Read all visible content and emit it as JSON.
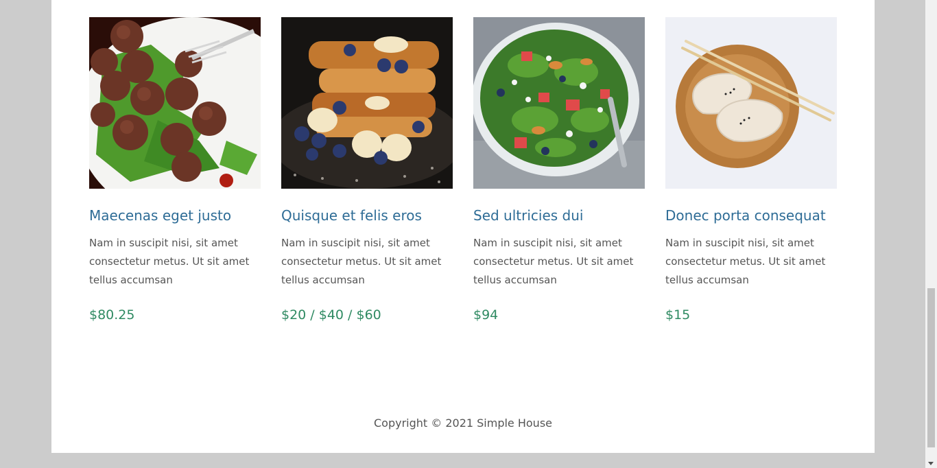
{
  "products": [
    {
      "title": "Maecenas eget justo",
      "description": "Nam in suscipit nisi, sit amet consectetur metus. Ut sit amet tellus accumsan",
      "price": "$80.25",
      "image": "meatballs-on-greens"
    },
    {
      "title": "Quisque et felis eros",
      "description": "Nam in suscipit nisi, sit amet consectetur metus. Ut sit amet tellus accumsan",
      "price": "$20 / $40 / $60",
      "image": "french-toast-with-berries"
    },
    {
      "title": "Sed ultricies dui",
      "description": "Nam in suscipit nisi, sit amet consectetur metus. Ut sit amet tellus accumsan",
      "price": "$94",
      "image": "salad-bowl"
    },
    {
      "title": "Donec porta consequat",
      "description": "Nam in suscipit nisi, sit amet consectetur metus. Ut sit amet tellus accumsan",
      "price": "$15",
      "image": "dumplings-with-chopsticks"
    }
  ],
  "footer": {
    "copyright": "Copyright © 2021 Simple House"
  },
  "colors": {
    "title": "#2e6c96",
    "price": "#2f8a62",
    "text": "#555555",
    "background": "#cccccc"
  }
}
